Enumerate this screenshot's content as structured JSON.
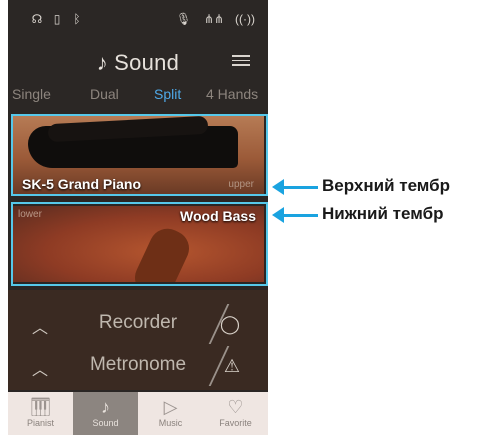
{
  "status_icons": [
    "headphones-icon",
    "usb-icon",
    "bluetooth-icon",
    "mic-icon",
    "equalizer-icon",
    "wireless-audio-icon"
  ],
  "header": {
    "title": "Sound",
    "icon": "note-icon"
  },
  "tabs": [
    {
      "label": "Single",
      "active": false
    },
    {
      "label": "Dual",
      "active": false
    },
    {
      "label": "Split",
      "active": true
    },
    {
      "label": "4 Hands",
      "active": false
    }
  ],
  "upper_card": {
    "name": "SK-5 Grand Piano",
    "tag": "upper"
  },
  "lower_card": {
    "name": "Wood Bass",
    "tag": "lower"
  },
  "rows": [
    {
      "label": "Recorder",
      "icon": "record-icon"
    },
    {
      "label": "Metronome",
      "icon": "metronome-icon"
    }
  ],
  "bottom_nav": [
    {
      "label": "Pianist",
      "active": false
    },
    {
      "label": "Sound",
      "active": true
    },
    {
      "label": "Music",
      "active": false
    },
    {
      "label": "Favorite",
      "active": false
    }
  ],
  "annotations": {
    "upper": "Верхний тембр",
    "lower": "Нижний тембр"
  },
  "colors": {
    "accent": "#4fa9e8",
    "highlight_frame": "#56c8ea",
    "arrow": "#1aa3e0"
  }
}
